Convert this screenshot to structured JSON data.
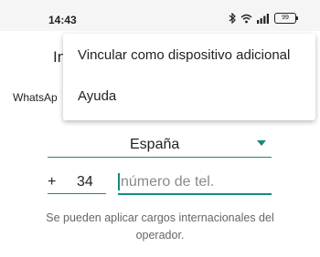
{
  "status_bar": {
    "time": "14:43",
    "battery": "99",
    "icons": [
      "bluetooth-icon",
      "wifi-icon",
      "signal-icon",
      "battery-icon"
    ]
  },
  "screen": {
    "title_partial": "In",
    "description_partial": "WhatsAp",
    "country": "España",
    "country_code_prefix": "+",
    "country_code": "34",
    "phone_placeholder": "número de tel.",
    "note": "Se pueden aplicar cargos internacionales del operador."
  },
  "menu": {
    "items": [
      {
        "label": "Vincular como dispositivo adicional"
      },
      {
        "label": "Ayuda"
      }
    ]
  },
  "colors": {
    "accent": "#128c7e",
    "status_bar_bg": "#f5f5f5"
  }
}
